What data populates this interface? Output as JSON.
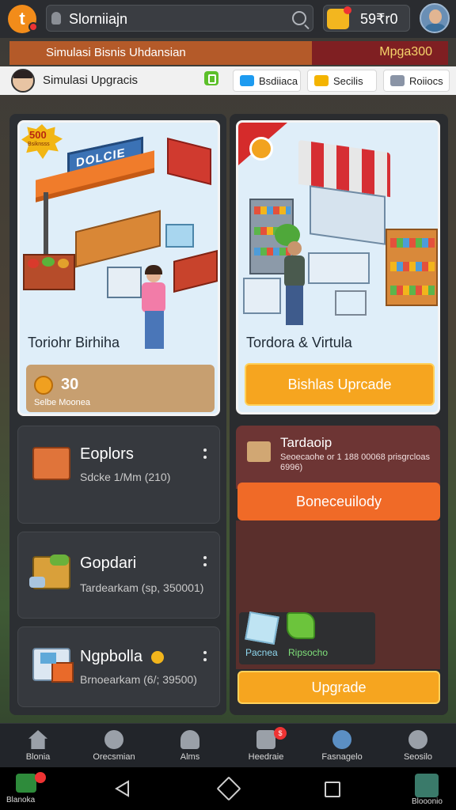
{
  "header": {
    "logo_letter": "t",
    "title": "Slorniiajn",
    "coins": "59₹r0"
  },
  "banner": {
    "left_text": "Simulasi Bisnis Uhdansian",
    "right_text": "Mpga300"
  },
  "subbar": {
    "label": "Simulasi Upgracis",
    "pills": [
      {
        "label": "Bsdiiaca",
        "icon": "bird-icon",
        "color": "#1d9bf0"
      },
      {
        "label": "Secilis",
        "icon": "ticket-icon",
        "color": "#f4b400"
      },
      {
        "label": "Roiiocs",
        "icon": "shield-icon",
        "color": "#8a94a6"
      }
    ]
  },
  "left_card": {
    "badge": "500",
    "badge_sub": "Bsiknsss",
    "sign": "DOLCIE",
    "title": "Toriohr Birhiha",
    "resource_value": "30",
    "resource_sub": "Selbe Moonea"
  },
  "right_card": {
    "title": "Tordora & Virtula",
    "button": "Bishlas Uprcade"
  },
  "items": [
    {
      "name": "Eoplors",
      "sub": "Sdcke 1/Mm (210)",
      "icon": "stand-icon"
    },
    {
      "name": "Gopdari",
      "sub": "Tardearkam (sp, 350001)",
      "icon": "crate-icon"
    },
    {
      "name": "Ngpbolla",
      "sub": "Brnoearkam (6/; 39500)",
      "icon": "machine-icon"
    }
  ],
  "info_card": {
    "title": "Tardaoip",
    "desc": "Seoecaohe or 1 188 00068 prisgrcloas 6996)"
  },
  "action_button": "Boneceuilody",
  "materials": [
    {
      "label": "Pacnea",
      "icon": "cube-icon"
    },
    {
      "label": "Ripsocho",
      "icon": "leaf-icon"
    }
  ],
  "upgrade_button": "Upgrade",
  "nav": [
    {
      "label": "Blonia",
      "icon": "home-icon"
    },
    {
      "label": "Orecsmian",
      "icon": "gear-icon",
      "badge": ""
    },
    {
      "label": "Alms",
      "icon": "people-icon"
    },
    {
      "label": "Heedraie",
      "icon": "board-icon",
      "badge": "$"
    },
    {
      "label": "Fasnagelo",
      "icon": "globe-icon"
    },
    {
      "label": "Seosilo",
      "icon": "user-icon"
    }
  ],
  "system": {
    "left_app_label": "Blanoka",
    "right_app_label": "Blooonio"
  }
}
